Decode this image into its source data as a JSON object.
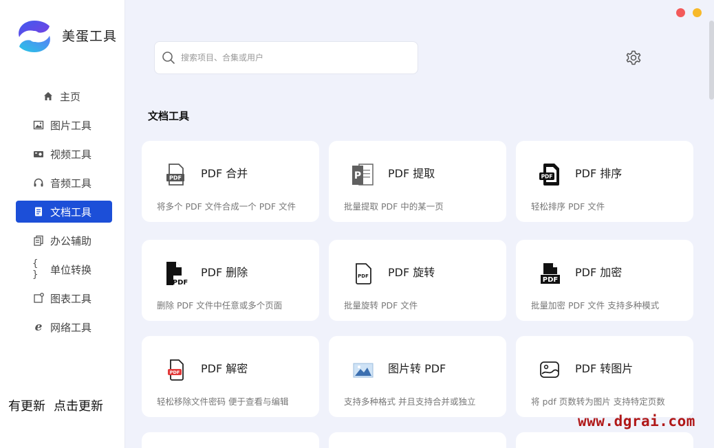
{
  "app": {
    "name": "美蛋工具"
  },
  "sidebar": {
    "items": [
      {
        "label": "主页",
        "icon": "home-icon"
      },
      {
        "label": "图片工具",
        "icon": "image-icon"
      },
      {
        "label": "视频工具",
        "icon": "video-icon"
      },
      {
        "label": "音频工具",
        "icon": "headphones-icon"
      },
      {
        "label": "文档工具",
        "icon": "document-icon",
        "active": true
      },
      {
        "label": "办公辅助",
        "icon": "copy-icon"
      },
      {
        "label": "单位转换",
        "icon": "braces-icon"
      },
      {
        "label": "图表工具",
        "icon": "chart-icon"
      },
      {
        "label": "网络工具",
        "icon": "browser-icon"
      }
    ],
    "update": {
      "status": "有更新",
      "action": "点击更新"
    }
  },
  "search": {
    "placeholder": "搜索项目、合集或用户"
  },
  "section": {
    "title": "文档工具"
  },
  "cards": [
    {
      "title": "PDF 合并",
      "desc": "将多个 PDF 文件合成一个 PDF 文件",
      "icon": "pdf-merge-icon"
    },
    {
      "title": "PDF 提取",
      "desc": "批量提取 PDF 中的某一页",
      "icon": "pdf-extract-icon"
    },
    {
      "title": "PDF 排序",
      "desc": "轻松排序 PDF 文件",
      "icon": "pdf-sort-icon"
    },
    {
      "title": "PDF 删除",
      "desc": "删除 PDF 文件中任意或多个页面",
      "icon": "pdf-delete-icon"
    },
    {
      "title": "PDF 旋转",
      "desc": "批量旋转 PDF 文件",
      "icon": "pdf-rotate-icon"
    },
    {
      "title": "PDF 加密",
      "desc": "批量加密 PDF 文件 支持多种模式",
      "icon": "pdf-encrypt-icon"
    },
    {
      "title": "PDF 解密",
      "desc": "轻松移除文件密码 便于查看与编辑",
      "icon": "pdf-decrypt-icon"
    },
    {
      "title": "图片转 PDF",
      "desc": "支持多种格式 并且支持合并或独立",
      "icon": "image-to-pdf-icon"
    },
    {
      "title": "PDF 转图片",
      "desc": "将 pdf 页数转为图片 支持特定页数",
      "icon": "pdf-to-image-icon"
    }
  ],
  "watermark": "www.dgrai.com",
  "colors": {
    "accent": "#1c4fd8",
    "close": "#f35a5a",
    "minimize": "#f7b92a",
    "watermark": "#b01818"
  }
}
